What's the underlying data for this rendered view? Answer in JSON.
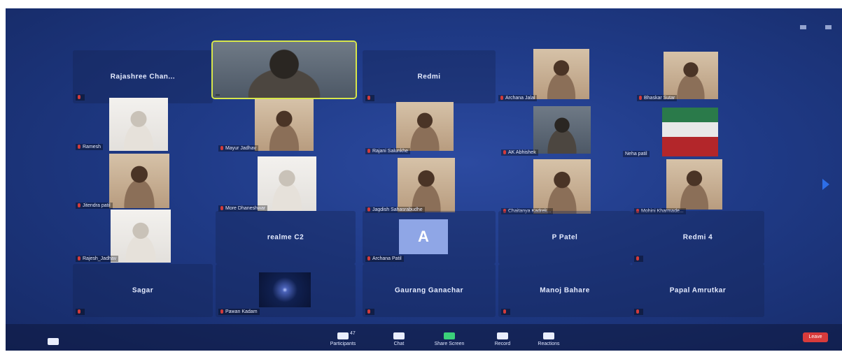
{
  "window": {
    "top_bar": {
      "view_1": "",
      "view_2": ""
    }
  },
  "tiles": [
    {
      "name": "Rajashree Chan..."
    },
    {
      "name": ""
    },
    {
      "name": "Redmi"
    },
    {
      "name": "Archana Jalal"
    },
    {
      "name": "Bhaskar Sutar"
    },
    {
      "name": "Ramesh"
    },
    {
      "name": "Mayur Jadhav"
    },
    {
      "name": "Rajani Salunkhe"
    },
    {
      "name": "AK Abhishek"
    },
    {
      "name": "Neha patil"
    },
    {
      "name": "Jitendra patil"
    },
    {
      "name": "More Dhaneshwar"
    },
    {
      "name": "Jagdish Sahasrabudhe"
    },
    {
      "name": "Chaitanya Kadrek..."
    },
    {
      "name": "Mohini Kharmade..."
    },
    {
      "name": "Rajesh_Jadhav"
    },
    {
      "name": "realme C2"
    },
    {
      "name": "Archana Patil",
      "avatar": "A"
    },
    {
      "name": "P Patel"
    },
    {
      "name": "Redmi 4"
    },
    {
      "name": "Sagar"
    },
    {
      "name": "Pawan Kadam"
    },
    {
      "name": "Gaurang Ganachar"
    },
    {
      "name": "Manoj Bahare"
    },
    {
      "name": "Papal Amrutkar"
    }
  ],
  "toolbar": {
    "video_label": "",
    "participants_label": "Participants",
    "participants_count": "47",
    "chat_label": "Chat",
    "share_label": "Share Screen",
    "record_label": "Record",
    "reactions_label": "Reactions",
    "end_label": "Leave"
  }
}
